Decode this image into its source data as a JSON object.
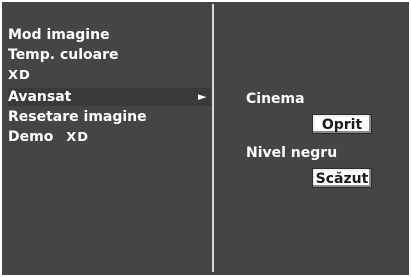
{
  "menu": {
    "items": [
      {
        "label": "Mod imagine"
      },
      {
        "label": "Temp. culoare"
      },
      {
        "label": "XD"
      },
      {
        "label": "Avansat",
        "arrow": "►"
      },
      {
        "label": "Resetare imagine"
      },
      {
        "label": "Demo",
        "logo": "XD"
      }
    ]
  },
  "submenu": {
    "cinema_label": "Cinema",
    "cinema_value": "Oprit",
    "black_level_label": "Nivel negru",
    "black_level_value": "Scăzut"
  },
  "colors": {
    "background": "#454545",
    "divider": "#d8d8d8",
    "value_box": "#ffffff"
  }
}
